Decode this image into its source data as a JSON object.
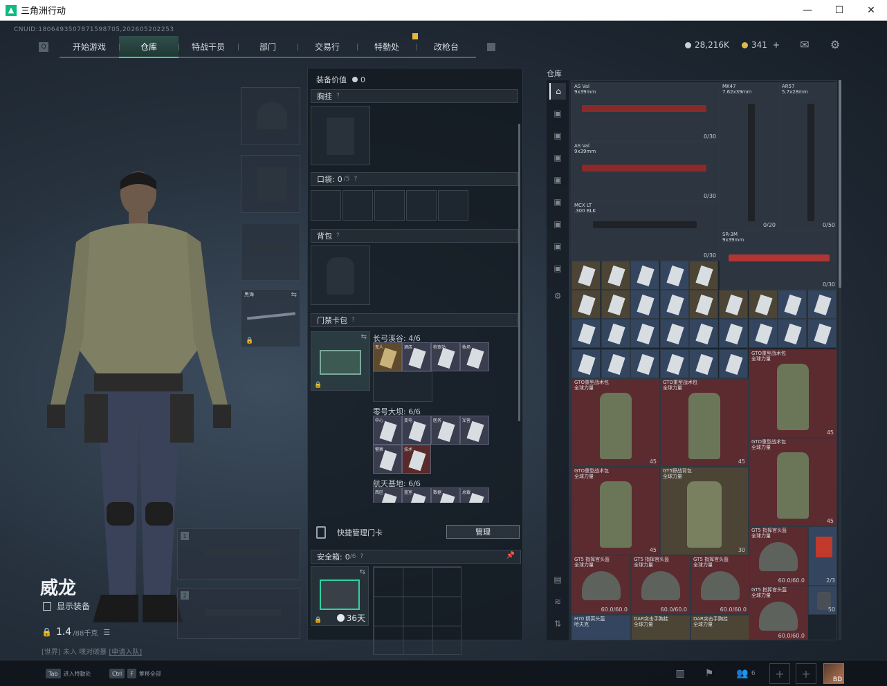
{
  "window": {
    "title": "三角洲行动",
    "buttons": [
      "—",
      "☐",
      "✕"
    ]
  },
  "uid": "CNUID:1806493507871598705,202605202253",
  "nav": {
    "tabs": [
      {
        "label": "开始游戏",
        "active": false
      },
      {
        "label": "仓库",
        "active": true
      },
      {
        "label": "特战干员",
        "active": false
      },
      {
        "label": "部门",
        "active": false
      },
      {
        "label": "交易行",
        "active": false
      },
      {
        "label": "特勤处",
        "active": false
      },
      {
        "label": "改枪台",
        "active": false
      }
    ]
  },
  "currency": {
    "coins": "28,216K",
    "tickets": "341",
    "add": "+"
  },
  "icons": {
    "mail": "mail-icon",
    "settings": "gear-icon"
  },
  "character": {
    "name": "威龙",
    "show_equipment": "显示装备",
    "weight": "1.4",
    "weight_unit": "/88千克",
    "team_line_tag": "[世界]",
    "team_line_text": " 未入 嘿对碳暴 ",
    "team_line_link": "[申请入队]",
    "melee_label": "黑海",
    "weapon_slot_1": "1",
    "weapon_slot_2": "2"
  },
  "equipment_panel": {
    "value_label": "装备价值",
    "value": "0",
    "chest_rig": "胸挂",
    "pockets": "口袋:",
    "pockets_count": "0",
    "pockets_max": "/5",
    "backpack": "背包",
    "keycard_bag": "门禁卡包",
    "help": "?",
    "card_groups": [
      {
        "label": "长弓溪谷: 4/6",
        "cards": [
          {
            "tag": "无人",
            "style": "gold"
          },
          {
            "tag": "酒店",
            "style": ""
          },
          {
            "tag": "检查站",
            "style": ""
          },
          {
            "tag": "牧场",
            "style": ""
          }
        ]
      },
      {
        "label": "零号大坝: 6/6",
        "cards": [
          {
            "tag": "中心",
            "style": ""
          },
          {
            "tag": "变电",
            "style": ""
          },
          {
            "tag": "医务",
            "style": ""
          },
          {
            "tag": "军营",
            "style": ""
          },
          {
            "tag": "警察",
            "style": ""
          },
          {
            "tag": "技术",
            "style": "red"
          }
        ]
      },
      {
        "label": "航天基地: 6/6",
        "cards": [
          {
            "tag": "西区",
            "style": ""
          },
          {
            "tag": "蓝室",
            "style": ""
          },
          {
            "tag": "数据",
            "style": ""
          },
          {
            "tag": "总裁",
            "style": ""
          }
        ]
      }
    ],
    "quick_manage": "快捷管理门卡",
    "manage_button": "管理",
    "safe_box": "安全箱:",
    "safe_count": "0",
    "safe_max": "/6",
    "safe_days": "36天"
  },
  "warehouse": {
    "label": "仓库",
    "items": [
      {
        "name": "AS Val\n9x39mm",
        "count": "0/30"
      },
      {
        "name": "MK47\n7.62x39mm",
        "count": "0/20"
      },
      {
        "name": "AR57\n5.7x28mm",
        "count": "0/50"
      },
      {
        "name": "AS Val\n9x39mm",
        "count": "0/30"
      },
      {
        "name": "MCX LT\n.300 BLK",
        "count": "0/30"
      },
      {
        "name": "SR-3M\n9x39mm",
        "count": "0/30"
      },
      {
        "name": "GTO重型战术包\n全球力量",
        "count": "45"
      },
      {
        "name": "GTO重型战术包\n全球力量",
        "count": "45"
      },
      {
        "name": "GTO重型战术包\n全球力量",
        "count": "45"
      },
      {
        "name": "GTO重型战术包\n全球力量",
        "count": "45"
      },
      {
        "name": "GTO重型战术包\n全球力量",
        "count": "45"
      },
      {
        "name": "GT5野战背包\n全球力量",
        "count": "30"
      },
      {
        "name": "GT5 指挥官头盔\n全球力量",
        "count": "60.0/60.0"
      },
      {
        "name": "GT5 指挥官头盔\n全球力量",
        "count": "60.0/60.0"
      },
      {
        "name": "GT5 指挥官头盔\n全球力量",
        "count": "60.0/60.0"
      },
      {
        "name": "GT5 指挥官头盔\n全球力量",
        "count": "60.0/60.0"
      },
      {
        "name": "GT5 指挥官头盔\n全球力量",
        "count": "60.0/60.0"
      },
      {
        "name": "H70 精英头盔\n哈夫克",
        "count": ""
      },
      {
        "name": "DAR突击手胸挂\n全球力量",
        "count": ""
      },
      {
        "name": "DAR突击手胸挂\n全球力量",
        "count": ""
      },
      {
        "name": "",
        "count": "2/3"
      },
      {
        "name": "",
        "count": "50"
      }
    ]
  },
  "bottom": {
    "hint1_key": "Tab",
    "hint1_text": "进入特勤处",
    "hint2_key1": "Ctrl",
    "hint2_key2": "F",
    "hint2_text": "筹移全部",
    "friends_count": "6",
    "plus": "+",
    "avatar_level": "BD"
  }
}
